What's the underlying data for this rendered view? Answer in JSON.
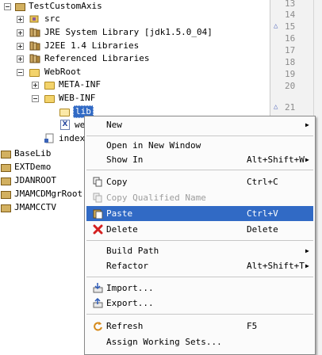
{
  "tree": {
    "items": [
      {
        "label": "TestCustomAxis",
        "icon": "project-icon"
      },
      {
        "label": "src",
        "icon": "source-folder-icon"
      },
      {
        "label": "JRE System Library [jdk1.5.0_04]",
        "icon": "library-icon"
      },
      {
        "label": "J2EE 1.4 Libraries",
        "icon": "library-icon"
      },
      {
        "label": "Referenced Libraries",
        "icon": "library-icon"
      },
      {
        "label": "WebRoot",
        "icon": "folder-icon"
      },
      {
        "label": "META-INF",
        "icon": "folder-icon"
      },
      {
        "label": "WEB-INF",
        "icon": "folder-icon"
      },
      {
        "label": "lib",
        "icon": "folder-icon"
      },
      {
        "label": "we",
        "icon": "xml-file-icon"
      },
      {
        "label": "index.",
        "icon": "jsp-file-icon"
      },
      {
        "label": "BaseLib",
        "icon": "project-icon"
      },
      {
        "label": "EXTDemo",
        "icon": "project-icon"
      },
      {
        "label": "JDANROOT",
        "icon": "project-icon"
      },
      {
        "label": "JMAMCDMgrRoot",
        "icon": "project-icon"
      },
      {
        "label": "JMAMCCTV",
        "icon": "project-icon"
      }
    ]
  },
  "gutter": {
    "lines": [
      "13",
      "14",
      "15",
      "16",
      "17",
      "18",
      "19",
      "20",
      "21"
    ]
  },
  "menu": {
    "new": {
      "label": "New"
    },
    "open_new_window": {
      "label": "Open in New Window"
    },
    "show_in": {
      "label": "Show In",
      "shortcut": "Alt+Shift+W"
    },
    "copy": {
      "label": "Copy",
      "shortcut": "Ctrl+C"
    },
    "copy_qualified": {
      "label": "Copy Qualified Name"
    },
    "paste": {
      "label": "Paste",
      "shortcut": "Ctrl+V"
    },
    "delete": {
      "label": "Delete",
      "shortcut": "Delete"
    },
    "build_path": {
      "label": "Build Path"
    },
    "refactor": {
      "label": "Refactor",
      "shortcut": "Alt+Shift+T"
    },
    "import": {
      "label": "Import..."
    },
    "export": {
      "label": "Export..."
    },
    "refresh": {
      "label": "Refresh",
      "shortcut": "F5"
    },
    "assign_ws": {
      "label": "Assign Working Sets..."
    }
  },
  "colors": {
    "selection": "#316ac5",
    "menu_bg": "#fbfbfb",
    "folder": "#f3d36b"
  }
}
